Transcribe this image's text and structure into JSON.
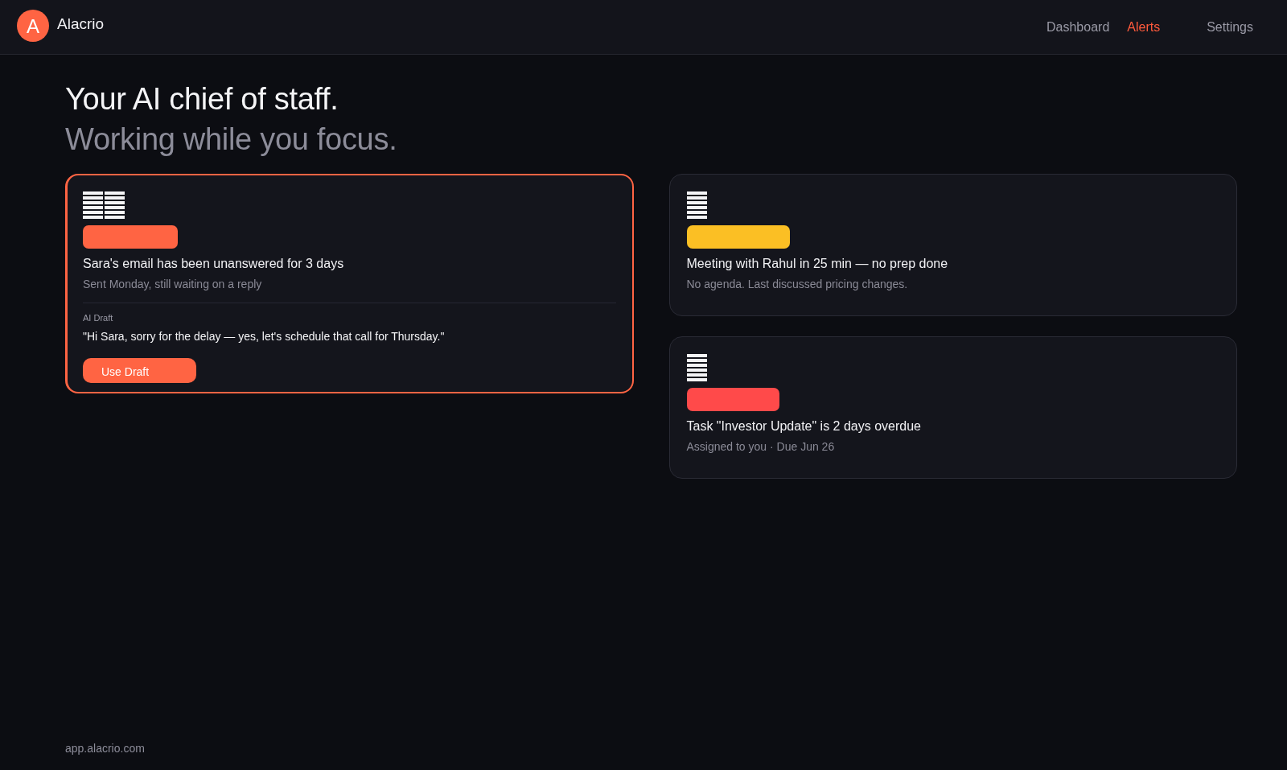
{
  "header": {
    "logo": {
      "letter": "A",
      "name": "Alacrio"
    },
    "nav": [
      {
        "label": "Dashboard",
        "selected": false
      },
      {
        "label": "Alerts",
        "selected": true
      },
      {
        "label": "Settings",
        "selected": false
      }
    ]
  },
  "hero": {
    "title": "Your AI chief of staff.",
    "subtitle": "Working while you focus."
  },
  "alerts": [
    {
      "kind": "email",
      "selected": true,
      "color": "#ff6443",
      "title": "Sara's email has been unanswered for 3 days",
      "detail": "Sent Monday, still waiting on a reply",
      "draft": {
        "label": "AI Draft",
        "text": "\"Hi Sara, sorry for the delay — yes, let's schedule that call for Thursday.\"",
        "button": "Use Draft"
      }
    },
    {
      "kind": "meeting",
      "selected": false,
      "color": "#fbbf24",
      "title": "Meeting with Rahul in 25 min — no prep done",
      "detail": "No agenda. Last discussed pricing changes."
    },
    {
      "kind": "task",
      "selected": false,
      "color": "#ff4a4a",
      "title": "Task \"Investor Update\" is 2 days overdue",
      "detail": "Assigned to you · Due Jun 26"
    }
  ],
  "footer": {
    "url": "app.alacrio.com"
  }
}
